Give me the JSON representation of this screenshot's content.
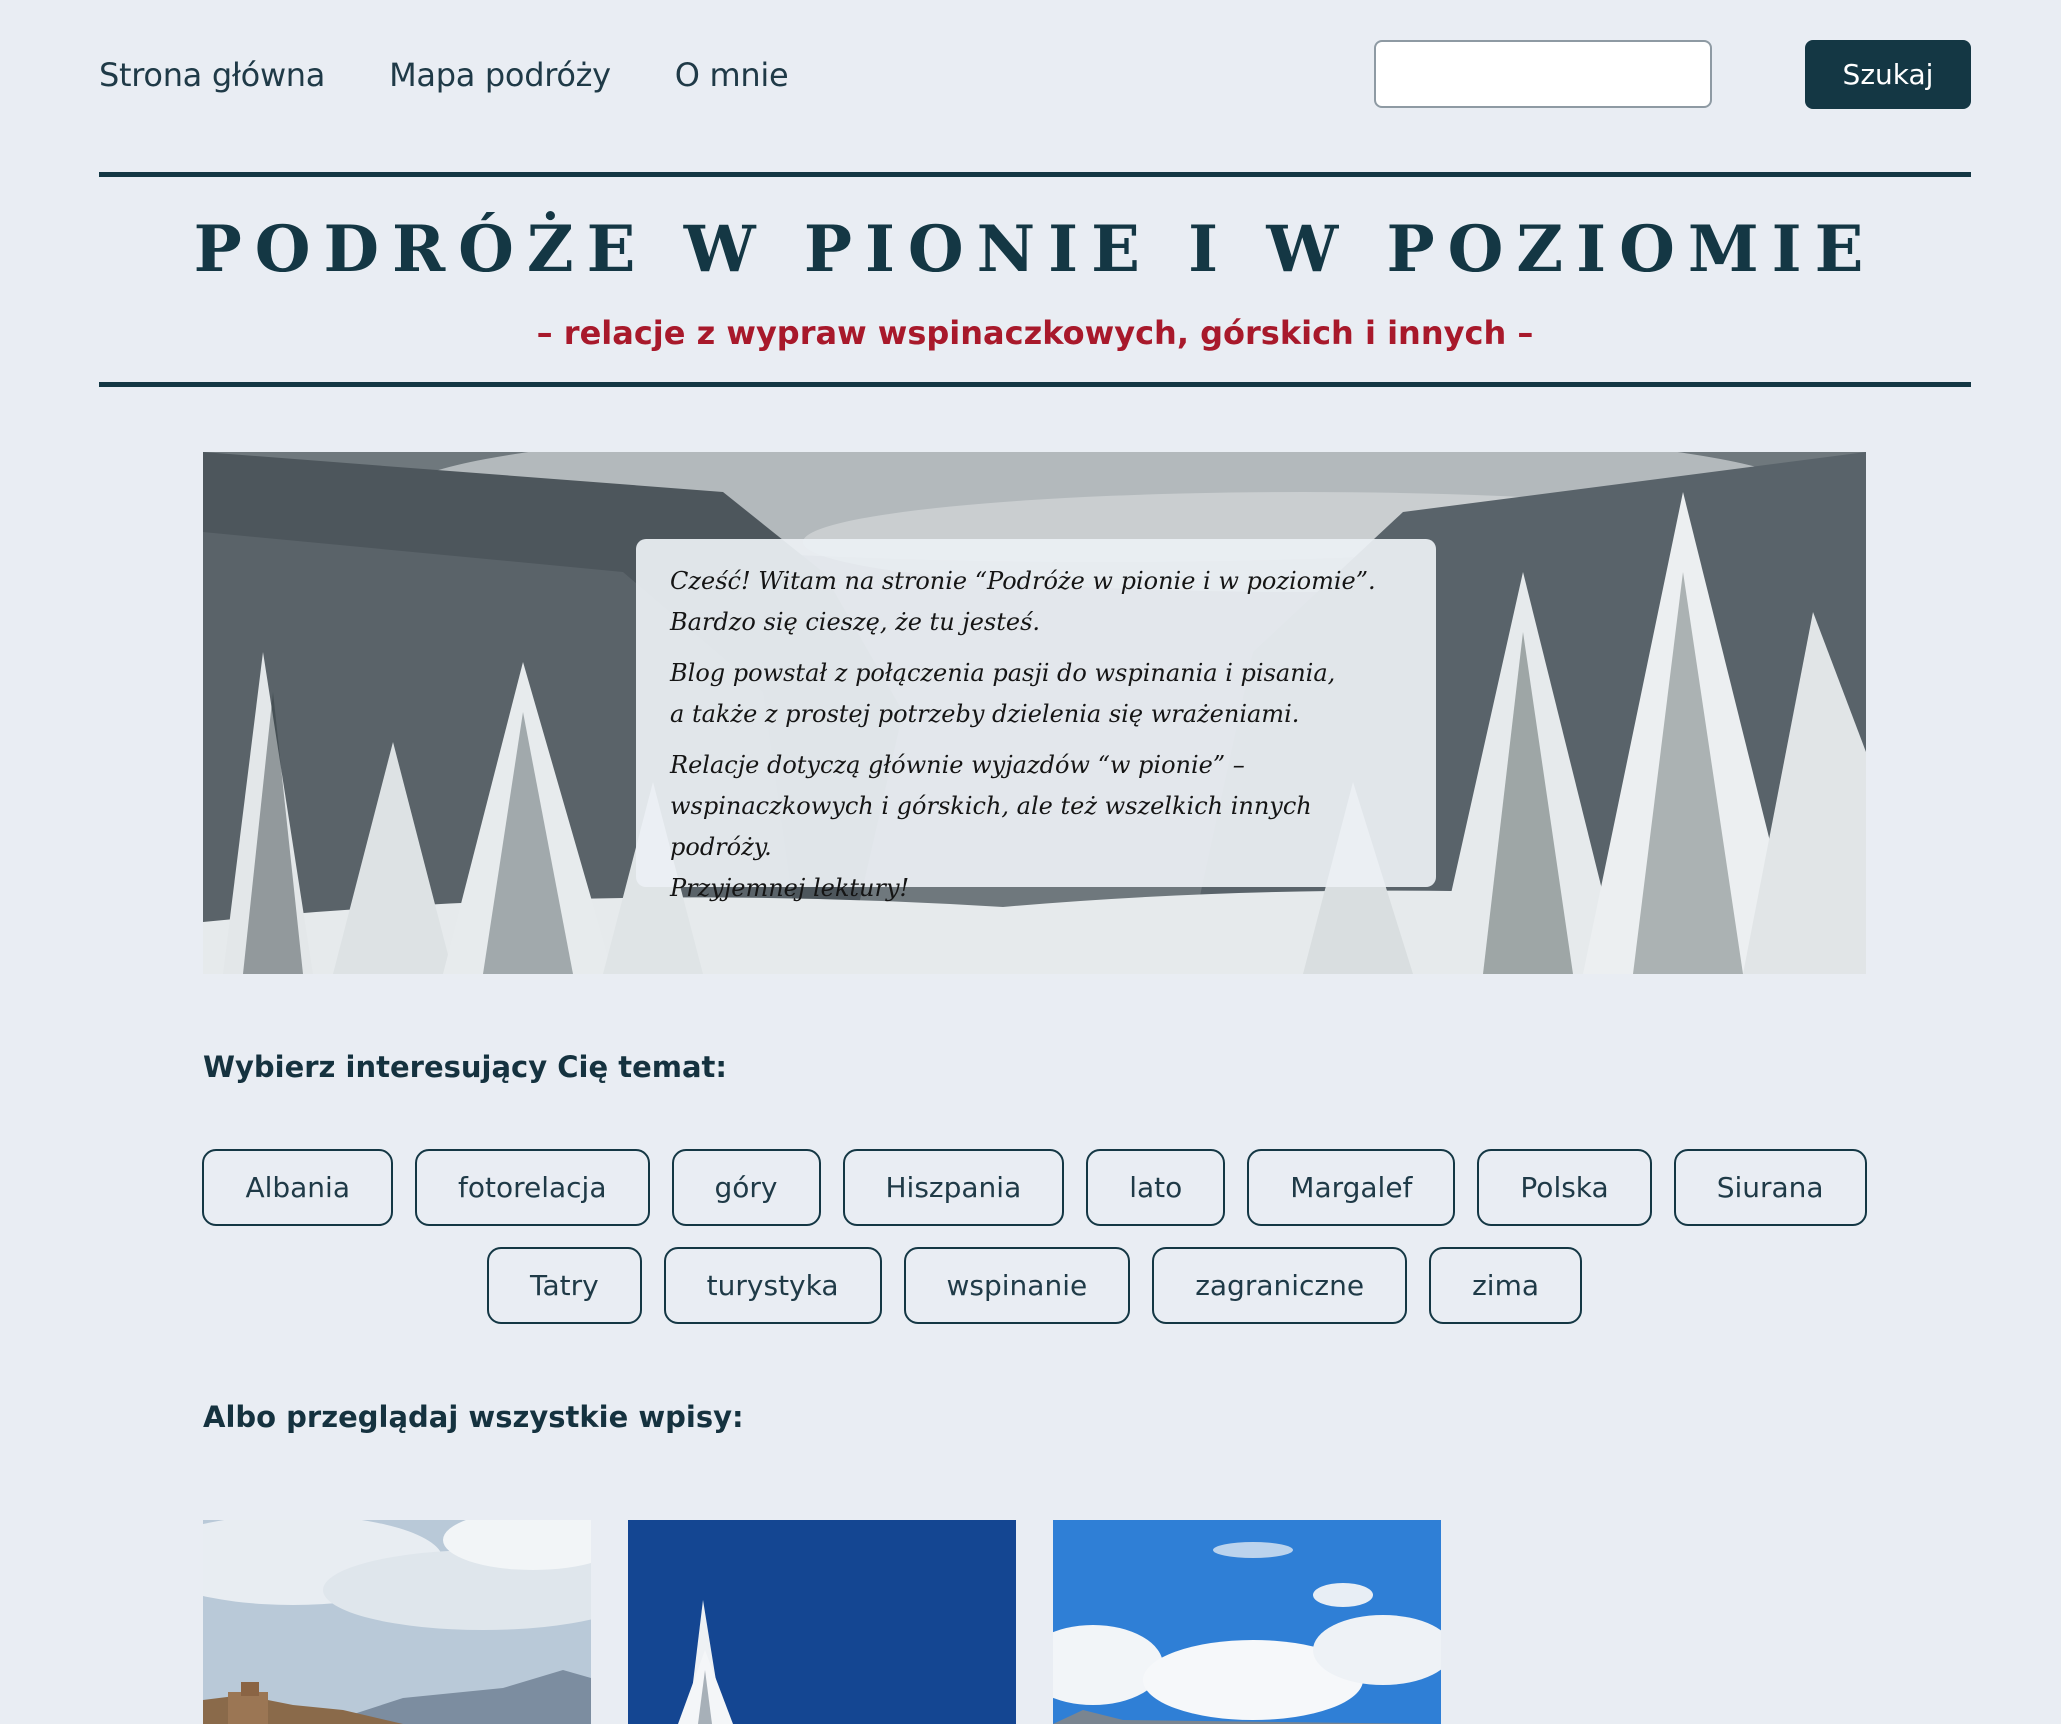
{
  "nav": {
    "links": [
      {
        "label": "Strona główna"
      },
      {
        "label": "Mapa podróży"
      },
      {
        "label": "O mnie"
      }
    ],
    "search": {
      "placeholder": "",
      "value": "",
      "button_label": "Szukaj"
    }
  },
  "header": {
    "title": "PODRÓŻE W PIONIE I W POZIOMIE",
    "subtitle": "– relacje z wypraw wspinaczkowych, górskich i innych –"
  },
  "hero": {
    "paragraphs": [
      "Cześć! Witam na stronie “Podróże w pionie i w poziomie”.\nBardzo się cieszę, że tu jesteś.",
      "Blog powstał z połączenia pasji do wspinania i pisania,\na także z prostej potrzeby dzielenia się wrażeniami.",
      "Relacje dotyczą głównie wyjazdów “w pionie” –\nwspinaczkowych i górskich, ale też wszelkich innych podróży.\nPrzyjemnej lektury!"
    ]
  },
  "topics": {
    "heading": "Wybierz interesujący Cię temat:",
    "row1": [
      "Albania",
      "fotorelacja",
      "góry",
      "Hiszpania",
      "lato",
      "Margalef",
      "Polska",
      "Siurana"
    ],
    "row2": [
      "Tatry",
      "turystyka",
      "wspinanie",
      "zagraniczne",
      "zima"
    ]
  },
  "posts": {
    "heading": "Albo przeglądaj wszystkie wpisy:"
  },
  "colors": {
    "background": "#e9edf3",
    "primary": "#143744",
    "accent": "#a8192b"
  }
}
